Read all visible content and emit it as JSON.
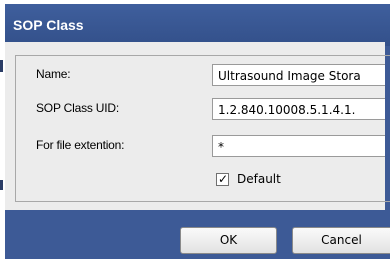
{
  "dialog": {
    "title": "SOP Class",
    "fields": {
      "name": {
        "label": "Name:",
        "value": "Ultrasound Image Stora"
      },
      "uid": {
        "label": "SOP Class UID:",
        "value": "1.2.840.10008.5.1.4.1."
      },
      "ext": {
        "label": "For file extention:",
        "value": "*"
      }
    },
    "default_checkbox": {
      "label": "Default",
      "checked": true
    },
    "buttons": {
      "ok": "OK",
      "cancel": "Cancel"
    }
  },
  "colors": {
    "titlebar": "#3d5a96",
    "panel": "#ececec"
  }
}
